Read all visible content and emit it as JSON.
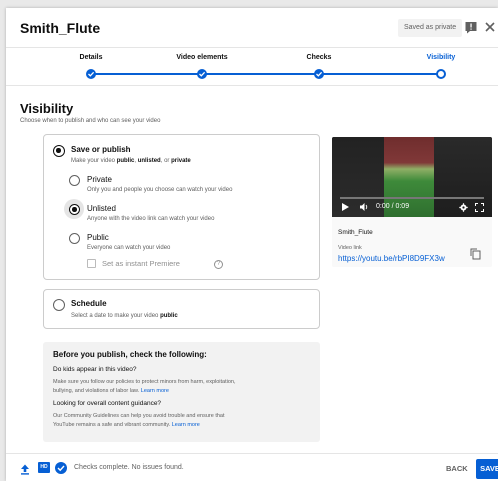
{
  "header": {
    "title": "Smith_Flute",
    "saved_badge": "Saved as private",
    "feedback_icon": "feedback-icon",
    "close_icon": "close-icon"
  },
  "stepper": {
    "steps": [
      {
        "label": "Details"
      },
      {
        "label": "Video elements"
      },
      {
        "label": "Checks"
      },
      {
        "label": "Visibility"
      }
    ],
    "accent_color": "#065fd4"
  },
  "visibility": {
    "heading": "Visibility",
    "subheading": "Choose when to publish and who can see your video",
    "save_or_publish": {
      "label": "Save or publish",
      "desc_prefix": "Make your video ",
      "desc_public": "public",
      "desc_sep1": ", ",
      "desc_unlisted": "unlisted",
      "desc_sep2": ", or ",
      "desc_private": "private"
    },
    "options": [
      {
        "label": "Private",
        "desc": "Only you and people you choose can watch your video"
      },
      {
        "label": "Unlisted",
        "desc": "Anyone with the video link can watch your video"
      },
      {
        "label": "Public",
        "desc": "Everyone can watch your video"
      }
    ],
    "selected_option": "Unlisted",
    "premiere_label": "Set as instant Premiere",
    "schedule": {
      "label": "Schedule",
      "desc_prefix": "Select a date to make your video ",
      "desc_bold": "public"
    }
  },
  "preview": {
    "time": "0:00 / 0:09",
    "video_name": "Smith_Flute",
    "link_label": "Video link",
    "link": "https://youtu.be/rbPI8D9FX3w"
  },
  "info": {
    "title": "Before you publish, check the following:",
    "q1": "Do kids appear in this video?",
    "p1_line1": "Make sure you follow our policies to protect minors from harm, exploitation,",
    "p1_line2": "bullying, and violations of labor law.",
    "p1_link": "Learn more",
    "q2": "Looking for overall content guidance?",
    "p2_line1": "Our Community Guidelines can help you avoid trouble and ensure that",
    "p2_line2": "YouTube remains a safe and vibrant community.",
    "p2_link": "Learn more"
  },
  "footer": {
    "hd_badge": "HD",
    "status": "Checks complete. No issues found.",
    "back_label": "BACK",
    "save_label": "SAVE"
  }
}
